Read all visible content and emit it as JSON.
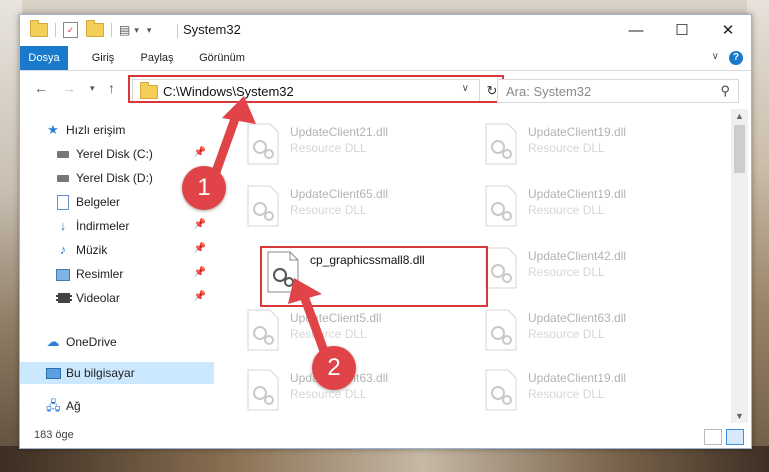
{
  "window": {
    "title": "System32",
    "controls": {
      "minimize": "—",
      "maximize": "☐",
      "close": "✕"
    }
  },
  "ribbon": {
    "tabs": [
      "Dosya",
      "Giriş",
      "Paylaş",
      "Görünüm"
    ],
    "active_tab": "Dosya",
    "help": "?"
  },
  "address": {
    "path": "C:\\Windows\\System32",
    "search_placeholder": "Ara: System32"
  },
  "nav_pane": {
    "items": [
      {
        "label": "Hızlı erişim",
        "icon": "star-icon"
      },
      {
        "label": "Yerel Disk (C:)",
        "icon": "drive-icon",
        "pinned": true
      },
      {
        "label": "Yerel Disk (D:)",
        "icon": "drive-icon"
      },
      {
        "label": "Belgeler",
        "icon": "documents-icon"
      },
      {
        "label": "İndirmeler",
        "icon": "download-icon",
        "pinned": true
      },
      {
        "label": "Müzik",
        "icon": "music-icon",
        "pinned": true
      },
      {
        "label": "Resimler",
        "icon": "pictures-icon",
        "pinned": true
      },
      {
        "label": "Videolar",
        "icon": "video-icon",
        "pinned": true
      },
      {
        "label": "OneDrive",
        "icon": "cloud-icon"
      },
      {
        "label": "Bu bilgisayar",
        "icon": "computer-icon",
        "selected": true
      },
      {
        "label": "Ağ",
        "icon": "network-icon"
      }
    ]
  },
  "files": [
    {
      "name": "UpdateClient21.dll",
      "desc": "Resource DLL"
    },
    {
      "name": "UpdateClient19.dll",
      "desc": "Resource DLL"
    },
    {
      "name": "UpdateClient65.dll",
      "desc": "Resource DLL"
    },
    {
      "name": "UpdateClient19.dll",
      "desc": "Resource DLL"
    },
    {
      "name": "cp_graphicssmall8.dll",
      "desc": ""
    },
    {
      "name": "UpdateClient42.dll",
      "desc": "Resource DLL"
    },
    {
      "name": "UpdateClient5.dll",
      "desc": "Resource DLL"
    },
    {
      "name": "UpdateClient63.dll",
      "desc": "Resource DLL"
    },
    {
      "name": "UpdateClient63.dll",
      "desc": "Resource DLL"
    },
    {
      "name": "UpdateClient19.dll",
      "desc": "Resource DLL"
    }
  ],
  "status": {
    "item_count": "183 öge"
  },
  "callouts": [
    "1",
    "2"
  ],
  "colors": {
    "accent": "#1979ca",
    "highlight": "#d9383a",
    "callout": "#e04448"
  }
}
